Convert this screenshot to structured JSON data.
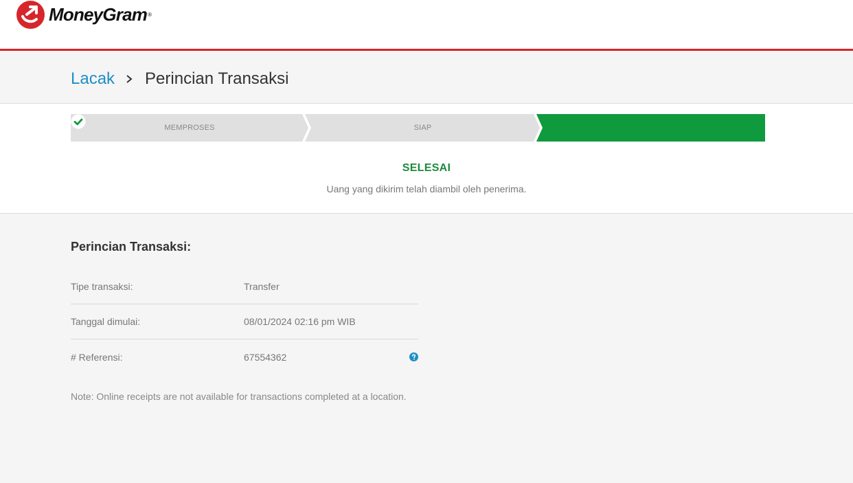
{
  "brand": {
    "name": "MoneyGram",
    "reg": "®",
    "color": "#d6262b"
  },
  "breadcrumb": {
    "link": "Lacak",
    "current": "Perincian Transaksi"
  },
  "progress": {
    "steps": [
      {
        "label": "MEMPROSES",
        "state": "done"
      },
      {
        "label": "SIAP",
        "state": "done"
      },
      {
        "label": "",
        "state": "current",
        "icon": "check-circle-icon"
      }
    ],
    "current_color": "#0f9a3e"
  },
  "status": {
    "title": "SELESAI",
    "description": "Uang yang dikirim telah diambil oleh penerima."
  },
  "details": {
    "title": "Perincian Transaksi:",
    "rows": [
      {
        "label": "Tipe transaksi:",
        "value": "Transfer"
      },
      {
        "label": "Tanggal dimulai:",
        "value": "08/01/2024 02:16 pm WIB"
      },
      {
        "label": "# Referensi:",
        "value": "67554362",
        "help": "question-circle-icon"
      }
    ]
  },
  "note": "Note: Online receipts are not available for transactions completed at a location."
}
